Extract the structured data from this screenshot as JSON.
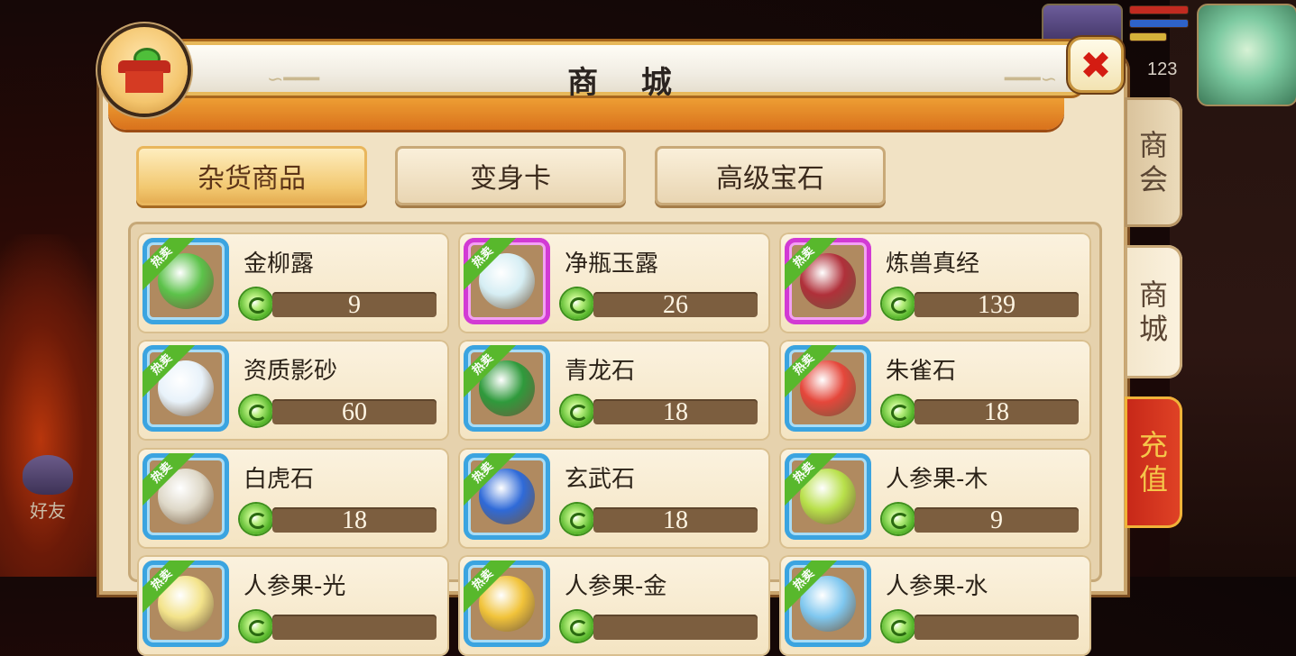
{
  "window": {
    "title": "商 城"
  },
  "tabs": [
    {
      "label": "杂货商品",
      "active": true
    },
    {
      "label": "变身卡",
      "active": false
    },
    {
      "label": "高级宝石",
      "active": false
    }
  ],
  "side_tabs": [
    {
      "label_1": "商",
      "label_2": "会"
    },
    {
      "label_1": "商",
      "label_2": "城"
    },
    {
      "label_1": "充",
      "label_2": "值"
    }
  ],
  "hot_badge": "热卖",
  "hud": {
    "level": "123",
    "friend_label": "好友"
  },
  "items": [
    {
      "name": "金柳露",
      "price": "9",
      "frame": "blue",
      "color": "#5cc24a"
    },
    {
      "name": "净瓶玉露",
      "price": "26",
      "frame": "purple",
      "color": "#d6eef4"
    },
    {
      "name": "炼兽真经",
      "price": "139",
      "frame": "purple",
      "color": "#b0303a"
    },
    {
      "name": "资质影砂",
      "price": "60",
      "frame": "blue",
      "color": "#e8f2fa"
    },
    {
      "name": "青龙石",
      "price": "18",
      "frame": "blue",
      "color": "#2f9a3c"
    },
    {
      "name": "朱雀石",
      "price": "18",
      "frame": "blue",
      "color": "#e5473b"
    },
    {
      "name": "白虎石",
      "price": "18",
      "frame": "blue",
      "color": "#ded8c8"
    },
    {
      "name": "玄武石",
      "price": "18",
      "frame": "blue",
      "color": "#2f6ad8"
    },
    {
      "name": "人参果-木",
      "price": "9",
      "frame": "blue",
      "color": "#b8e04a"
    },
    {
      "name": "人参果-光",
      "price": "",
      "frame": "blue",
      "color": "#f3e38a"
    },
    {
      "name": "人参果-金",
      "price": "",
      "frame": "blue",
      "color": "#f1c33a"
    },
    {
      "name": "人参果-水",
      "price": "",
      "frame": "blue",
      "color": "#7fc7ef"
    }
  ]
}
